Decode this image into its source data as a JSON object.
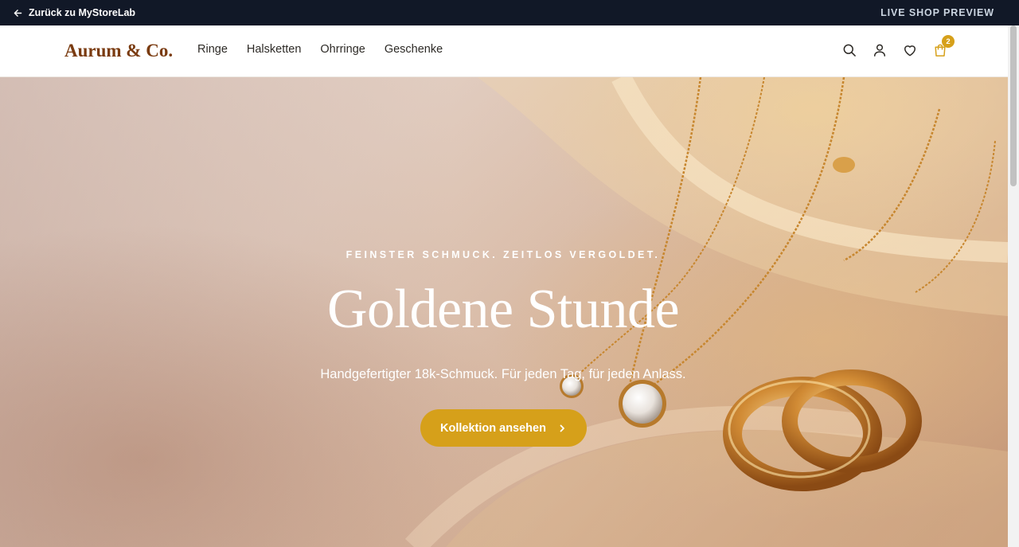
{
  "preview_bar": {
    "back_label": "Zurück zu MyStoreLab",
    "mode_label": "LIVE SHOP PREVIEW"
  },
  "header": {
    "logo": "Aurum & Co.",
    "nav": [
      {
        "label": "Ringe"
      },
      {
        "label": "Halsketten"
      },
      {
        "label": "Ohrringe"
      },
      {
        "label": "Geschenke"
      }
    ],
    "icons": [
      "search-icon",
      "user-icon",
      "heart-icon",
      "shopping-bag-icon"
    ],
    "cart_count": "2"
  },
  "hero": {
    "eyebrow": "FEINSTER SCHMUCK. ZEITLOS VERGOLDET.",
    "title": "Goldene Stunde",
    "subtitle": "Handgefertigter 18k-Schmuck. Für jeden Tag, für jeden Anlass.",
    "cta_label": "Kollektion ansehen"
  },
  "colors": {
    "top_bar": "#111827",
    "logo": "#7a3b10",
    "accent_gold": "#d6a01a",
    "nav_text": "#2d2a26"
  }
}
